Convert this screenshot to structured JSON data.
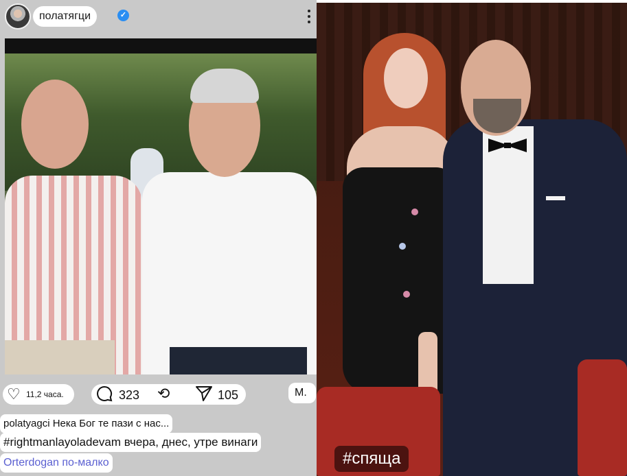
{
  "post": {
    "username": "полатягци",
    "likes": "11,2 часа.",
    "comments": "323",
    "shares": "105",
    "save_label": "M.",
    "caption": {
      "line1": "polatyagci Нека Бог те пази с нас...",
      "line2": "#rightmanlayoladevam вчера, днес, утре винаги",
      "line3": "Orterdogan по-малко"
    }
  },
  "story": {
    "sticker": "#спяща"
  },
  "icons": {
    "verified": "verified-badge-icon",
    "more": "more-vertical-icon",
    "like": "heart-icon",
    "comment": "comment-bubble-icon",
    "repost": "repost-icon",
    "share": "send-icon"
  },
  "colors": {
    "verified_blue": "#2a8ef2",
    "panel_gray": "#c9c9c9",
    "link_blue": "#5a5fd1"
  }
}
